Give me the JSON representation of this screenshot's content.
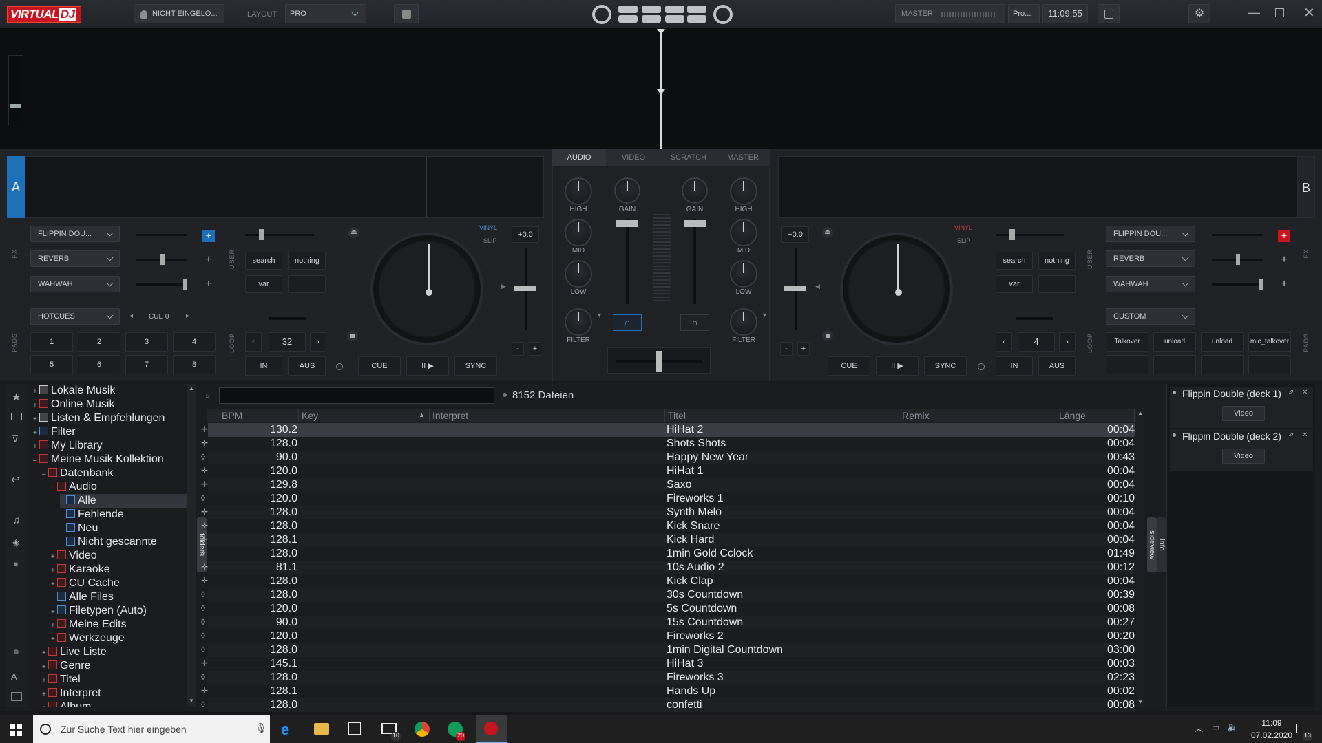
{
  "app": {
    "logo": "VIRTUAL",
    "logo_dj": "DJ",
    "user": "NICHT EINGELO...",
    "layout_label": "LAYOUT",
    "layout_value": "PRO",
    "master_label": "MASTER",
    "master_profile": "Pro...",
    "clock": "11:09:55"
  },
  "mixer": {
    "tabs": [
      "AUDIO",
      "VIDEO",
      "SCRATCH",
      "MASTER"
    ],
    "gain": "GAIN",
    "high": "HIGH",
    "mid": "MID",
    "low": "LOW",
    "filter": "FILTER"
  },
  "deckA": {
    "letter": "A",
    "fx": [
      "FLIPPIN DOU...",
      "REVERB",
      "WAHWAH"
    ],
    "fx_label": "FX",
    "user_label": "USER",
    "pads_label": "PADS",
    "loop_label": "LOOP",
    "pad_mode": "HOTCUES",
    "cue_sel": "CUE 0",
    "pads": [
      "1",
      "2",
      "3",
      "4",
      "5",
      "6",
      "7",
      "8"
    ],
    "user_btns": [
      "search",
      "nothing",
      "var",
      ""
    ],
    "loop_len": "32",
    "in": "IN",
    "out": "AUS",
    "vinyl": "VINYL",
    "slip": "SLIP",
    "pitch": "+0.0",
    "cue": "CUE",
    "play": "II ▶",
    "sync": "SYNC",
    "minus": "-",
    "plus": "+"
  },
  "deckB": {
    "letter": "B",
    "fx": [
      "FLIPPIN DOU...",
      "REVERB",
      "WAHWAH"
    ],
    "fx_label": "FX",
    "user_label": "USER",
    "pads_label": "PADS",
    "loop_label": "LOOP",
    "pad_mode": "CUSTOM",
    "pads": [
      "Talkover",
      "unload",
      "unload",
      "mic_talkover",
      "",
      "",
      "",
      ""
    ],
    "user_btns": [
      "search",
      "nothing",
      "var",
      ""
    ],
    "loop_len": "4",
    "in": "IN",
    "out": "AUS",
    "vinyl": "VINYL",
    "slip": "SLIP",
    "pitch": "+0.0",
    "cue": "CUE",
    "play": "II ▶",
    "sync": "SYNC",
    "minus": "-",
    "plus": "+"
  },
  "browser": {
    "file_count": "8152 Dateien",
    "search_value": "",
    "folders_tab": "folders",
    "sideview_tab": "sideview",
    "info_tab": "info",
    "columns": [
      "BPM",
      "Key",
      "Interpret",
      "Titel",
      "Remix",
      "Länge"
    ],
    "tree": [
      {
        "label": "Lokale Musik",
        "indent": 0,
        "icon": "white",
        "sign": "+"
      },
      {
        "label": "Online Musik",
        "indent": 0,
        "icon": "red",
        "sign": "+"
      },
      {
        "label": "Listen & Empfehlungen",
        "indent": 0,
        "icon": "white",
        "sign": "+"
      },
      {
        "label": "Filter",
        "indent": 0,
        "icon": "blue",
        "sign": "+"
      },
      {
        "label": "My Library",
        "indent": 0,
        "icon": "red",
        "sign": "+"
      },
      {
        "label": "Meine Musik Kollektion",
        "indent": 0,
        "icon": "red",
        "sign": "-"
      },
      {
        "label": "Datenbank",
        "indent": 1,
        "icon": "red",
        "sign": "-"
      },
      {
        "label": "Audio",
        "indent": 2,
        "icon": "red",
        "sign": "-"
      },
      {
        "label": "Alle",
        "indent": 3,
        "icon": "blue",
        "sign": "",
        "selected": true
      },
      {
        "label": "Fehlende",
        "indent": 3,
        "icon": "blue",
        "sign": ""
      },
      {
        "label": "Neu",
        "indent": 3,
        "icon": "blue",
        "sign": ""
      },
      {
        "label": "Nicht gescannte",
        "indent": 3,
        "icon": "blue",
        "sign": ""
      },
      {
        "label": "Video",
        "indent": 2,
        "icon": "red",
        "sign": "+"
      },
      {
        "label": "Karaoke",
        "indent": 2,
        "icon": "red",
        "sign": "+"
      },
      {
        "label": "CU Cache",
        "indent": 2,
        "icon": "red",
        "sign": "+"
      },
      {
        "label": "Alle Files",
        "indent": 2,
        "icon": "blue",
        "sign": ""
      },
      {
        "label": "Filetypen (Auto)",
        "indent": 2,
        "icon": "blue",
        "sign": "+"
      },
      {
        "label": "Meine Edits",
        "indent": 2,
        "icon": "red",
        "sign": "+"
      },
      {
        "label": "Werkzeuge",
        "indent": 2,
        "icon": "red",
        "sign": "+"
      },
      {
        "label": "Live Liste",
        "indent": 1,
        "icon": "red",
        "sign": "+"
      },
      {
        "label": "Genre",
        "indent": 1,
        "icon": "red",
        "sign": "+"
      },
      {
        "label": "Titel",
        "indent": 1,
        "icon": "red",
        "sign": "+"
      },
      {
        "label": "Interpret",
        "indent": 1,
        "icon": "red",
        "sign": "+"
      },
      {
        "label": "Album",
        "indent": 1,
        "icon": "red",
        "sign": "+"
      }
    ],
    "tracks": [
      {
        "bpm": "130.2",
        "title": "HiHat 2",
        "length": "00:04",
        "type": "sample"
      },
      {
        "bpm": "128.0",
        "title": "Shots Shots",
        "length": "00:04",
        "type": "sample"
      },
      {
        "bpm": "90.0",
        "title": "Happy New Year",
        "length": "00:43",
        "type": "video"
      },
      {
        "bpm": "120.0",
        "title": "HiHat 1",
        "length": "00:04",
        "type": "sample"
      },
      {
        "bpm": "129.8",
        "title": "Saxo",
        "length": "00:04",
        "type": "sample"
      },
      {
        "bpm": "120.0",
        "title": "Fireworks 1",
        "length": "00:10",
        "type": "video"
      },
      {
        "bpm": "128.0",
        "title": "Synth Melo",
        "length": "00:04",
        "type": "sample"
      },
      {
        "bpm": "128.0",
        "title": "Kick Snare",
        "length": "00:04",
        "type": "sample"
      },
      {
        "bpm": "128.1",
        "title": "Kick Hard",
        "length": "00:04",
        "type": "sample"
      },
      {
        "bpm": "128.0",
        "title": "1min Gold Cclock",
        "length": "01:49",
        "type": "video"
      },
      {
        "bpm": "81.1",
        "title": "10s Audio 2",
        "length": "00:12",
        "type": "sample"
      },
      {
        "bpm": "128.0",
        "title": "Kick Clap",
        "length": "00:04",
        "type": "sample"
      },
      {
        "bpm": "128.0",
        "title": "30s Countdown",
        "length": "00:39",
        "type": "video"
      },
      {
        "bpm": "120.0",
        "title": "5s Countdown",
        "length": "00:08",
        "type": "video"
      },
      {
        "bpm": "90.0",
        "title": "15s Countdown",
        "length": "00:27",
        "type": "video"
      },
      {
        "bpm": "120.0",
        "title": "Fireworks 2",
        "length": "00:20",
        "type": "video"
      },
      {
        "bpm": "128.0",
        "title": "1min Digital Countdown",
        "length": "03:00",
        "type": "video"
      },
      {
        "bpm": "145.1",
        "title": "HiHat 3",
        "length": "00:03",
        "type": "sample"
      },
      {
        "bpm": "128.0",
        "title": "Fireworks 3",
        "length": "02:23",
        "type": "video"
      },
      {
        "bpm": "128.1",
        "title": "Hands Up",
        "length": "00:02",
        "type": "sample"
      },
      {
        "bpm": "128.0",
        "title": "confetti",
        "length": "00:08",
        "type": "video"
      }
    ],
    "sideview": [
      {
        "title": "Flippin Double (deck 1)",
        "btn": "Video"
      },
      {
        "title": "Flippin Double (deck 2)",
        "btn": "Video"
      }
    ]
  },
  "taskbar": {
    "search_placeholder": "Zur Suche Text hier eingeben",
    "time": "11:09",
    "date": "07.02.2020",
    "mail_badge": "10",
    "chrome_badge": "20",
    "notif_badge": "13"
  },
  "colors": {
    "accent_red": "#c8141e",
    "accent_blue": "#1d6fb8",
    "bg": "#16171b"
  }
}
